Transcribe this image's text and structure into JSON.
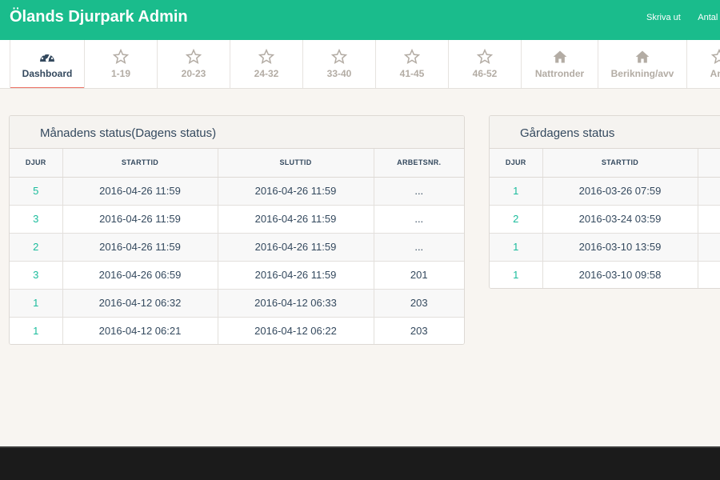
{
  "header": {
    "brand": "Ölands Djurpark Admin",
    "links": [
      "Skriva ut",
      "Antal"
    ],
    "color": "#1abc8c"
  },
  "nav": {
    "items": [
      {
        "label": "Dashboard",
        "icon": "dashboard-icon",
        "active": true
      },
      {
        "label": "1-19",
        "icon": "star-icon"
      },
      {
        "label": "20-23",
        "icon": "star-icon"
      },
      {
        "label": "24-32",
        "icon": "star-icon"
      },
      {
        "label": "33-40",
        "icon": "star-icon"
      },
      {
        "label": "41-45",
        "icon": "star-icon"
      },
      {
        "label": "46-52",
        "icon": "star-icon"
      },
      {
        "label": "Nattronder",
        "icon": "home-icon"
      },
      {
        "label": "Berikning/avv",
        "icon": "home-icon"
      },
      {
        "label": "Ans",
        "icon": "star-icon"
      }
    ],
    "active_color": "#ec7063"
  },
  "monthly": {
    "title": "Månadens status(Dagens status)",
    "columns": [
      "DJUR",
      "STARTTID",
      "SLUTTID",
      "ARBETSNR."
    ],
    "rows": [
      [
        "5",
        "2016-04-26 11:59",
        "2016-04-26 11:59",
        "..."
      ],
      [
        "3",
        "2016-04-26 11:59",
        "2016-04-26 11:59",
        "..."
      ],
      [
        "2",
        "2016-04-26 11:59",
        "2016-04-26 11:59",
        "..."
      ],
      [
        "3",
        "2016-04-26 06:59",
        "2016-04-26 11:59",
        "201"
      ],
      [
        "1",
        "2016-04-12 06:32",
        "2016-04-12 06:33",
        "203"
      ],
      [
        "1",
        "2016-04-12 06:21",
        "2016-04-12 06:22",
        "203"
      ]
    ]
  },
  "farm": {
    "title": "Gårdagens status",
    "columns": [
      "DJUR",
      "STARTTID"
    ],
    "rows": [
      [
        "1",
        "2016-03-26 07:59"
      ],
      [
        "2",
        "2016-03-24 03:59"
      ],
      [
        "1",
        "2016-03-10 13:59"
      ],
      [
        "1",
        "2016-03-10 09:58"
      ]
    ]
  }
}
